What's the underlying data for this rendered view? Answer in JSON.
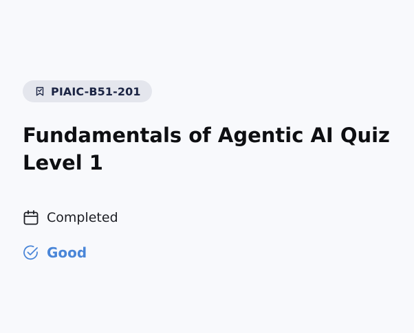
{
  "quiz": {
    "code": "PIAIC-B51-201",
    "title": "Fundamentals of Agentic AI Quiz Level 1",
    "status": "Completed",
    "grade": "Good"
  },
  "icons": {
    "badge": "bookmark-check-icon",
    "status": "calendar-icon",
    "grade": "check-circle-icon"
  },
  "colors": {
    "background": "#f8f9fc",
    "badge_background": "#e4e6ed",
    "badge_text": "#1b2443",
    "title": "#0e0f12",
    "grade_accent": "#4a86d8"
  }
}
